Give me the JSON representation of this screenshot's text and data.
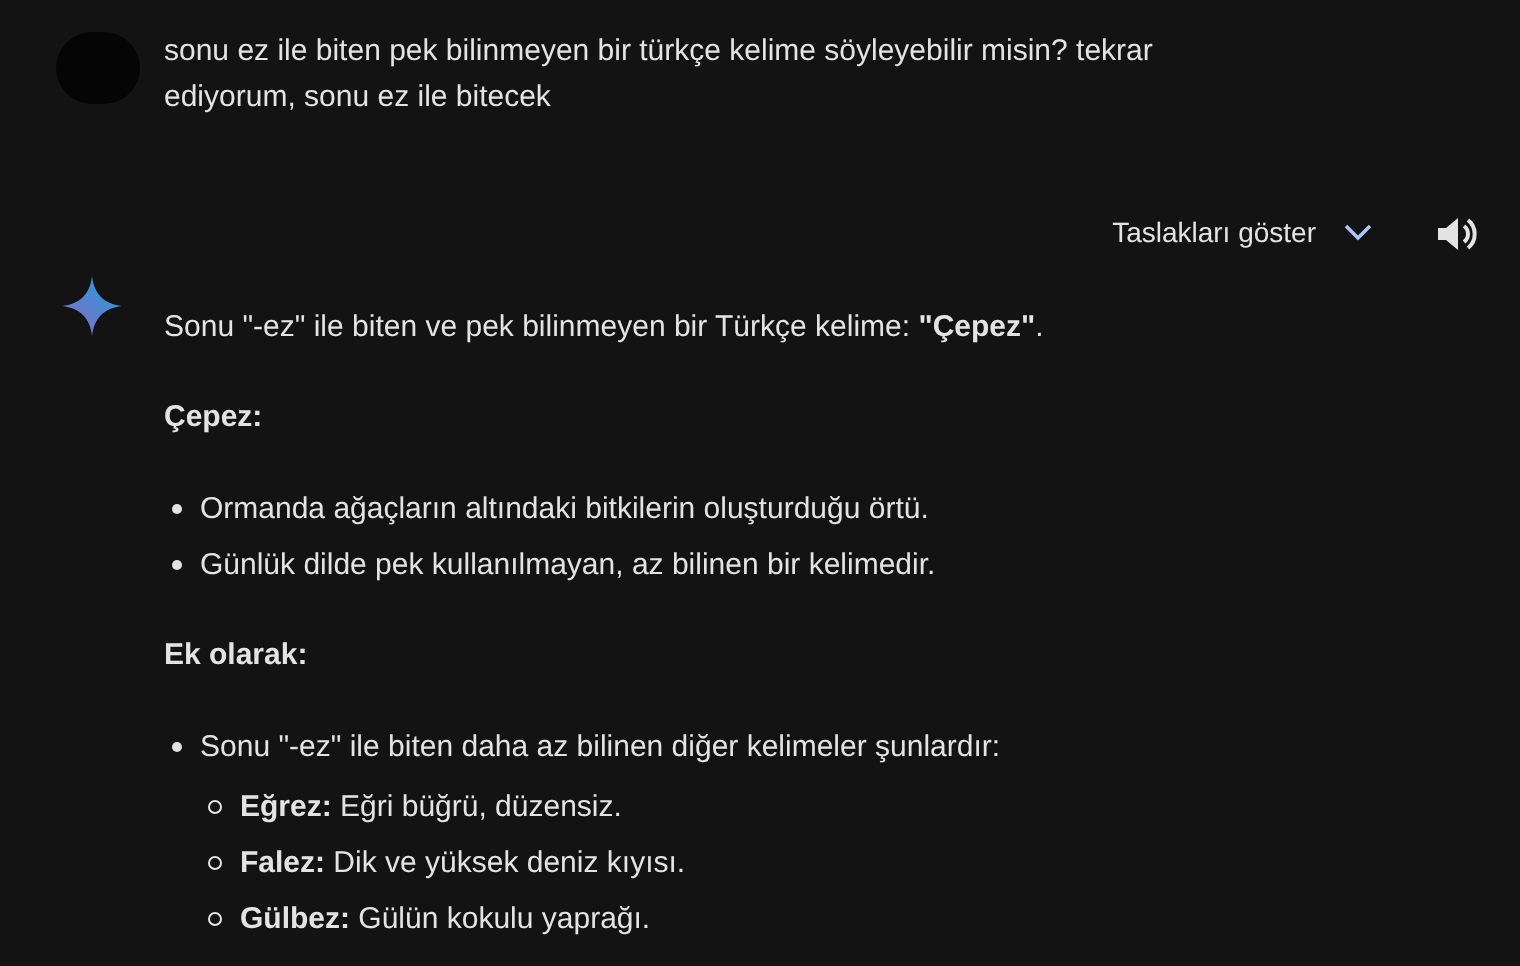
{
  "prompt": {
    "text": "sonu ez ile biten pek bilinmeyen bir türkçe kelime söyleyebilir misin? tekrar ediyorum, sonu ez ile bitecek"
  },
  "drafts": {
    "label": "Taslakları göster",
    "expanded": false
  },
  "response": [
    {
      "kind": "paragraph",
      "text": "Sonu \"-ez\" ile biten ve pek bilinmeyen bir Türkçe kelime: **\"Çepez\"**."
    },
    {
      "kind": "heading",
      "text": "Çepez:"
    },
    {
      "kind": "bullets",
      "items": [
        {
          "text": "Ormanda ağaçların altındaki bitkilerin oluşturduğu örtü."
        },
        {
          "text": "Günlük dilde pek kullanılmayan, az bilinen bir kelimedir."
        }
      ]
    },
    {
      "kind": "heading",
      "text": "Ek olarak:"
    },
    {
      "kind": "bullets",
      "items": [
        {
          "text": "Sonu \"-ez\" ile biten daha az bilinen diğer kelimeler şunlardır:",
          "children": [
            {
              "text": "**Eğrez:** Eğri büğrü, düzensiz."
            },
            {
              "text": "**Falez:** Dik ve yüksek deniz kıyısı."
            },
            {
              "text": "**Gülbez:** Gülün kokulu yaprağı."
            }
          ]
        }
      ]
    }
  ]
}
